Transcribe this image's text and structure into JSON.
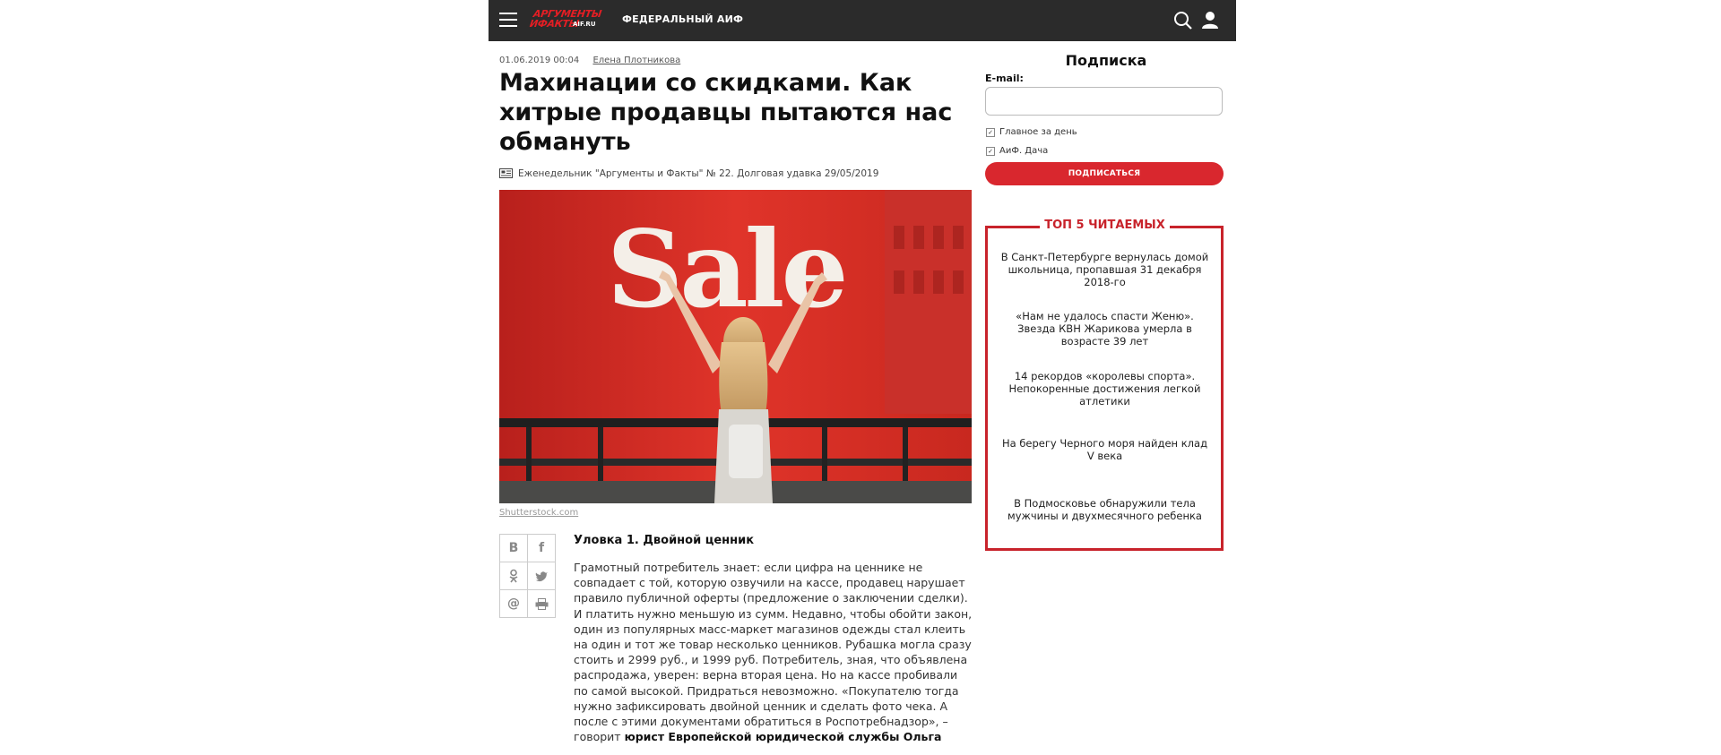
{
  "header": {
    "logo_line1": "АРГУМЕНТЫ",
    "logo_line2": "ИФАКТЫ",
    "logo_domain": "AIF.RU",
    "nav_label": "ФЕДЕРАЛЬНЫЙ АИФ",
    "icons": [
      "menu-icon",
      "search-icon",
      "user-icon"
    ]
  },
  "article": {
    "date": "01.06.2019 00:04",
    "author": "Елена Плотникова",
    "title": "Махинации со скидками. Как хитрые продавцы пытаются нас обмануть",
    "issue": "Еженедельник \"Аргументы и Факты\" № 22. Долговая удавка 29/05/2019",
    "image_text": "Sale",
    "image_credit": "Shutterstock.com",
    "subhead": "Уловка 1. Двойной ценник",
    "body": "Грамотный потребитель знает: если цифра на ценнике не совпадает с той, которую озвучили на кассе, продавец нарушает правило публичной оферты (предложение о заключении сделки). И платить нужно меньшую из сумм. Недавно, чтобы обойти закон, один из популярных масс-маркет магазинов одежды стал клеить на один и тот же товар несколько ценников. Рубашка могла сразу стоить и 2999 руб., и 1999 руб. Потребитель, зная, что объявлена распродажа, уверен: верна вторая цена. Но на кассе пробивали по самой высокой. Придраться невозможно. «Покупателю тогда нужно зафиксировать двойной ценник и сделать фото чека. А после с этими документами обратиться в Роспотребнадзор», – говорит",
    "body_bold": "юрист Европейской юридической службы Ольга",
    "share_labels": [
      "В",
      "f",
      "ок",
      "tw",
      "@",
      "print"
    ]
  },
  "sidebar": {
    "subscribe_title": "Подписка",
    "email_label": "E-mail:",
    "email_value": "",
    "checkbox1": "Главное за день",
    "checkbox2": "АиФ. Дача",
    "subscribe_button": "ПОДПИСАТЬСЯ",
    "top5_title": "ТОП 5 ЧИТАЕМЫХ",
    "top5_items": [
      "В Санкт-Петербурге вернулась домой школьница, пропавшая 31 декабря 2018-го",
      "«Нам не удалось спасти Женю». Звезда КВН Жарикова умерла в возрасте 39 лет",
      "14 рекордов «королевы спорта». Непокоренные достижения легкой атлетики",
      "На берегу Черного моря найден клад V века",
      "В Подмосковье обнаружили тела мужчины и двухмесячного ребенка"
    ]
  },
  "colors": {
    "header_bg": "#2b2b2b",
    "brand_red": "#e31e24",
    "accent_red": "#d9272e"
  }
}
